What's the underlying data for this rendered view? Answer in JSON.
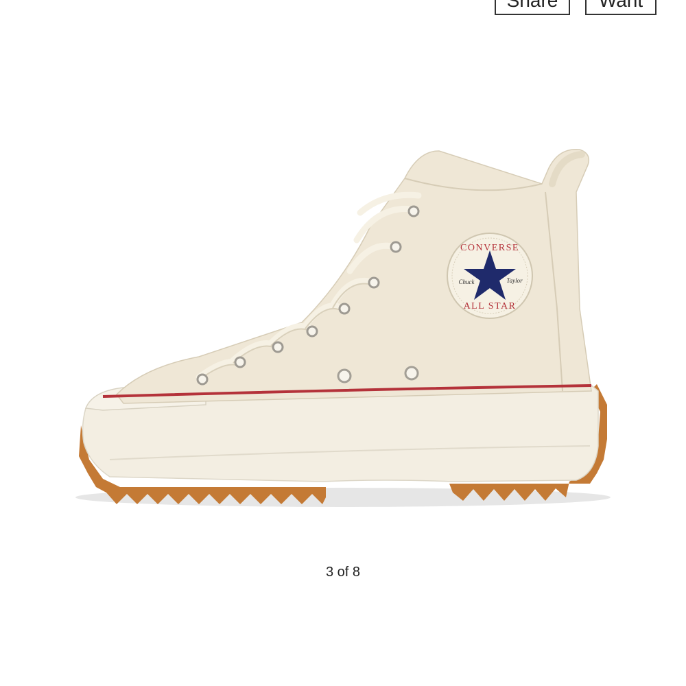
{
  "actions": {
    "share_label": "Share",
    "want_label": "Want"
  },
  "gallery": {
    "counter": "3 of 8",
    "image_alt": "",
    "badge": {
      "top_text": "CONVERSE",
      "bottom_text": "ALL STAR",
      "left_script": "Chuck",
      "right_script": "Taylor"
    }
  },
  "colors": {
    "canvas": "#efe7d6",
    "sole": "#f3eee2",
    "stripe": "#b4323a",
    "gum": "#c47a35",
    "star": "#1f2a6b"
  }
}
